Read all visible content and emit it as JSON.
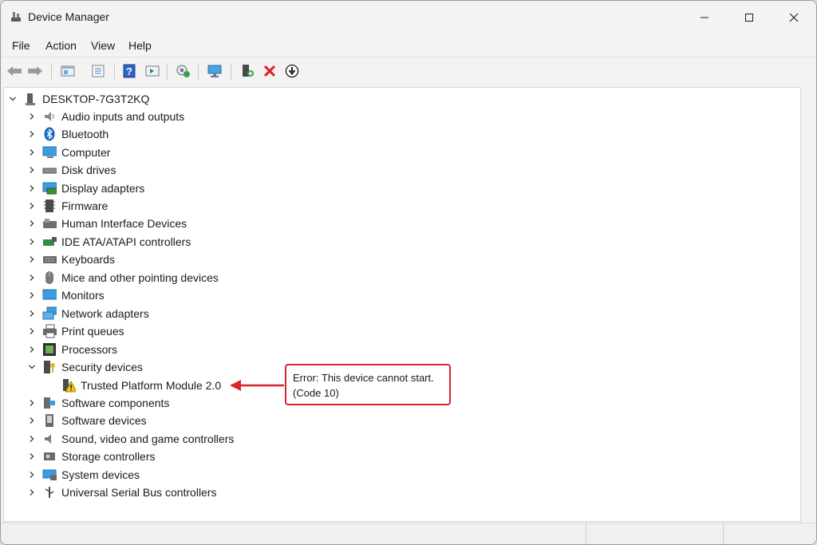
{
  "window": {
    "title": "Device Manager",
    "controls": {
      "minimize": "minimize",
      "maximize": "maximize",
      "close": "close"
    }
  },
  "menu": {
    "file": "File",
    "action": "Action",
    "view": "View",
    "help": "Help"
  },
  "toolbar": {
    "buttons": [
      "back-icon",
      "forward-icon",
      "properties-window-icon",
      "details-icon",
      "help-icon",
      "run-icon",
      "scan-hardware-icon",
      "monitor-icon",
      "add-driver-icon",
      "uninstall-icon",
      "update-driver-icon"
    ]
  },
  "tree": {
    "root": "DESKTOP-7G3T2KQ",
    "categories": [
      {
        "label": "Audio inputs and outputs"
      },
      {
        "label": "Bluetooth"
      },
      {
        "label": "Computer"
      },
      {
        "label": "Disk drives"
      },
      {
        "label": "Display adapters"
      },
      {
        "label": "Firmware"
      },
      {
        "label": "Human Interface Devices"
      },
      {
        "label": "IDE ATA/ATAPI controllers"
      },
      {
        "label": "Keyboards"
      },
      {
        "label": "Mice and other pointing devices"
      },
      {
        "label": "Monitors"
      },
      {
        "label": "Network adapters"
      },
      {
        "label": "Print queues"
      },
      {
        "label": "Processors"
      },
      {
        "label": "Security devices",
        "expanded": true
      },
      {
        "label": "Software components"
      },
      {
        "label": "Software devices"
      },
      {
        "label": "Sound, video and game controllers"
      },
      {
        "label": "Storage controllers"
      },
      {
        "label": "System devices"
      },
      {
        "label": "Universal Serial Bus controllers"
      }
    ],
    "child": {
      "label": "Trusted Platform Module 2.0",
      "status": "warning"
    }
  },
  "callout": {
    "line1": "Error: This device cannot start.",
    "line2": "(Code 10)",
    "color": "#d6262b"
  }
}
